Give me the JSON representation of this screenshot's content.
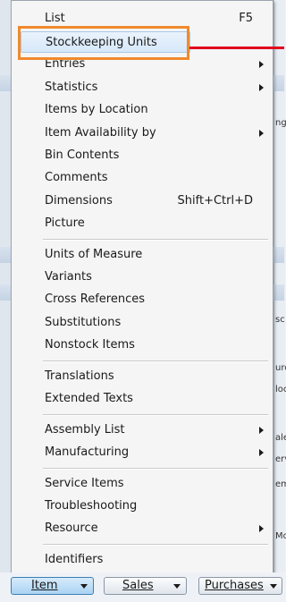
{
  "menu": {
    "items": [
      {
        "label": "List",
        "shortcut": "F5"
      },
      {
        "label": "Stockkeeping Units",
        "shortcut": ""
      },
      {
        "label": "Entries",
        "shortcut": ""
      },
      {
        "label": "Statistics",
        "shortcut": ""
      },
      {
        "label": "Items by Location",
        "shortcut": ""
      },
      {
        "label": "Item Availability by",
        "shortcut": ""
      },
      {
        "label": "Bin Contents",
        "shortcut": ""
      },
      {
        "label": "Comments",
        "shortcut": ""
      },
      {
        "label": "Dimensions",
        "shortcut": "Shift+Ctrl+D"
      },
      {
        "label": "Picture",
        "shortcut": ""
      },
      {
        "label": "Units of Measure",
        "shortcut": ""
      },
      {
        "label": "Variants",
        "shortcut": ""
      },
      {
        "label": "Cross References",
        "shortcut": ""
      },
      {
        "label": "Substitutions",
        "shortcut": ""
      },
      {
        "label": "Nonstock Items",
        "shortcut": ""
      },
      {
        "label": "Translations",
        "shortcut": ""
      },
      {
        "label": "Extended Texts",
        "shortcut": ""
      },
      {
        "label": "Assembly List",
        "shortcut": ""
      },
      {
        "label": "Manufacturing",
        "shortcut": ""
      },
      {
        "label": "Service Items",
        "shortcut": ""
      },
      {
        "label": "Troubleshooting",
        "shortcut": ""
      },
      {
        "label": "Resource",
        "shortcut": ""
      },
      {
        "label": "Identifiers",
        "shortcut": ""
      }
    ]
  },
  "toolbar": {
    "item_label": "Item",
    "sales_label": "Sales",
    "purchases_label": "Purchases"
  },
  "background": {
    "fragments": [
      "ng",
      "sc",
      "urc",
      "loc",
      "ale",
      "erv",
      "em",
      "Mo"
    ]
  },
  "colors": {
    "callout_box": "#f08a2c",
    "callout_line": "#e0001b",
    "active_button": "#a9d3f3"
  }
}
